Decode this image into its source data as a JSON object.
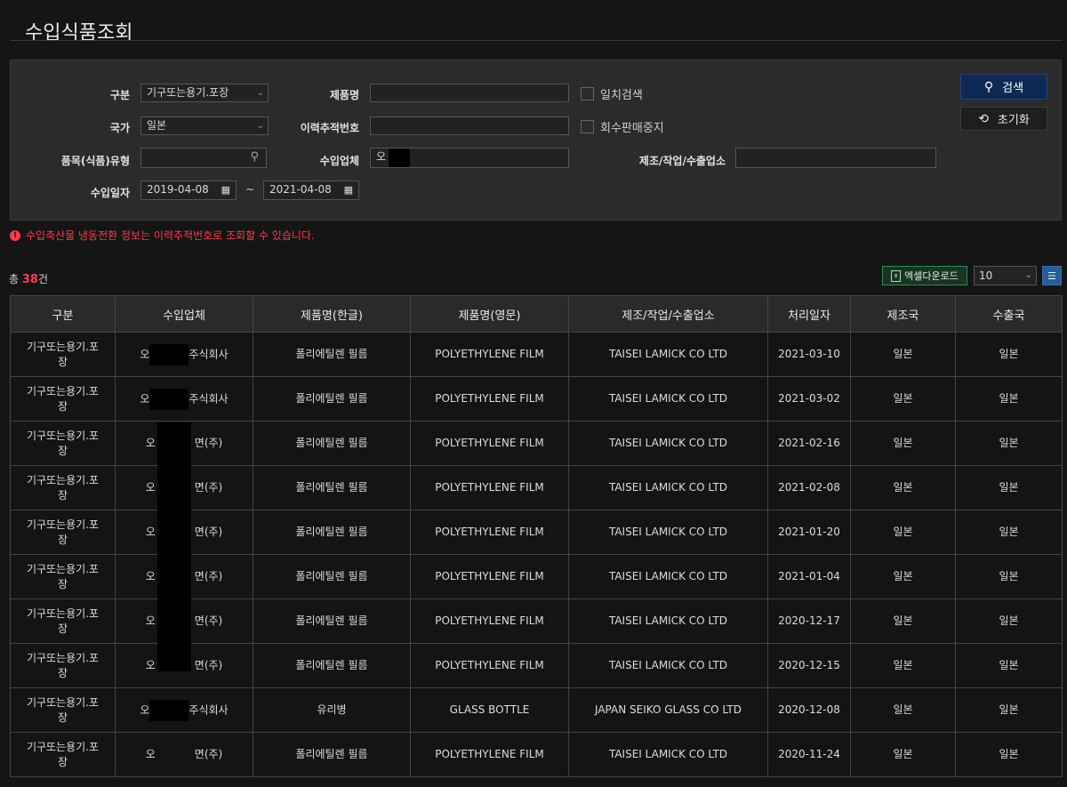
{
  "page": {
    "title": "수입식품조회"
  },
  "search": {
    "category_label": "구분",
    "category_value": "기구또는용기.포장",
    "country_label": "국가",
    "country_value": "일본",
    "item_type_label": "품목(식품)유형",
    "item_type_value": "",
    "date_label": "수입일자",
    "date_from": "2019-04-08",
    "date_sep": "~",
    "date_to": "2021-04-08",
    "product_label": "제품명",
    "product_value": "",
    "trace_label": "이력추적번호",
    "trace_value": "",
    "importer_label": "수입업체",
    "importer_value": "오",
    "exact_label": "일치검색",
    "recall_label": "회수판매중지",
    "maker_label": "제조/작업/수출업소",
    "maker_value": "",
    "search_button": "검색",
    "reset_button": "초기화"
  },
  "notice": "수입축산물 냉동전환 정보는 이력추적번호로 조회할 수 있습니다.",
  "results": {
    "total_prefix": "총",
    "total_count": "38",
    "total_suffix": "건",
    "excel_button": "엑셀다운로드",
    "page_size": "10",
    "columns": [
      "구분",
      "수입업체",
      "제품명(한글)",
      "제품명(영문)",
      "제조/작업/수출업소",
      "처리일자",
      "제조국",
      "수출국"
    ],
    "rows": [
      {
        "category": "기구또는용기.포장",
        "importer_prefix": "오",
        "importer_suffix": "주식회사",
        "name_ko": "폴리에틸렌 필름",
        "name_en": "POLYETHYLENE FILM",
        "maker": "TAISEI LAMICK CO LTD",
        "date": "2021-03-10",
        "made_in": "일본",
        "export_from": "일본"
      },
      {
        "category": "기구또는용기.포장",
        "importer_prefix": "오",
        "importer_suffix": "주식회사",
        "name_ko": "폴리에틸렌 필름",
        "name_en": "POLYETHYLENE FILM",
        "maker": "TAISEI LAMICK CO LTD",
        "date": "2021-03-02",
        "made_in": "일본",
        "export_from": "일본"
      },
      {
        "category": "기구또는용기.포장",
        "importer_prefix": "오",
        "importer_suffix": "면(주)",
        "name_ko": "폴리에틸렌 필름",
        "name_en": "POLYETHYLENE FILM",
        "maker": "TAISEI LAMICK CO LTD",
        "date": "2021-02-16",
        "made_in": "일본",
        "export_from": "일본"
      },
      {
        "category": "기구또는용기.포장",
        "importer_prefix": "오",
        "importer_suffix": "면(주)",
        "name_ko": "폴리에틸렌 필름",
        "name_en": "POLYETHYLENE FILM",
        "maker": "TAISEI LAMICK CO LTD",
        "date": "2021-02-08",
        "made_in": "일본",
        "export_from": "일본"
      },
      {
        "category": "기구또는용기.포장",
        "importer_prefix": "오",
        "importer_suffix": "면(주)",
        "name_ko": "폴리에틸렌 필름",
        "name_en": "POLYETHYLENE FILM",
        "maker": "TAISEI LAMICK CO LTD",
        "date": "2021-01-20",
        "made_in": "일본",
        "export_from": "일본"
      },
      {
        "category": "기구또는용기.포장",
        "importer_prefix": "오",
        "importer_suffix": "면(주)",
        "name_ko": "폴리에틸렌 필름",
        "name_en": "POLYETHYLENE FILM",
        "maker": "TAISEI LAMICK CO LTD",
        "date": "2021-01-04",
        "made_in": "일본",
        "export_from": "일본"
      },
      {
        "category": "기구또는용기.포장",
        "importer_prefix": "오",
        "importer_suffix": "면(주)",
        "name_ko": "폴리에틸렌 필름",
        "name_en": "POLYETHYLENE FILM",
        "maker": "TAISEI LAMICK CO LTD",
        "date": "2020-12-17",
        "made_in": "일본",
        "export_from": "일본"
      },
      {
        "category": "기구또는용기.포장",
        "importer_prefix": "오",
        "importer_suffix": "면(주)",
        "name_ko": "폴리에틸렌 필름",
        "name_en": "POLYETHYLENE FILM",
        "maker": "TAISEI LAMICK CO LTD",
        "date": "2020-12-15",
        "made_in": "일본",
        "export_from": "일본"
      },
      {
        "category": "기구또는용기.포장",
        "importer_prefix": "오",
        "importer_suffix": "주식회사",
        "name_ko": "유리병",
        "name_en": "GLASS BOTTLE",
        "maker": "JAPAN SEIKO GLASS CO LTD",
        "date": "2020-12-08",
        "made_in": "일본",
        "export_from": "일본"
      },
      {
        "category": "기구또는용기.포장",
        "importer_prefix": "오",
        "importer_suffix": "면(주)",
        "name_ko": "폴리에틸렌 필름",
        "name_en": "POLYETHYLENE FILM",
        "maker": "TAISEI LAMICK CO LTD",
        "date": "2020-11-24",
        "made_in": "일본",
        "export_from": "일본"
      }
    ]
  }
}
